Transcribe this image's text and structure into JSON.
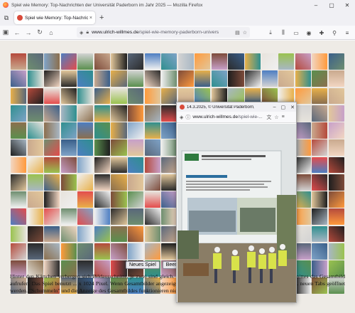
{
  "window": {
    "title": "Spiel wie Memory: Top-Nachrichten der Universität Paderborn im Jahr 2025 — Mozilla Firefox",
    "min_icon": "minimize-icon",
    "max_icon": "maximize-icon",
    "close_icon": "close-icon"
  },
  "tab": {
    "label": "Spiel wie Memory: Top-Nachrichten",
    "close": "×",
    "new": "+"
  },
  "nav": {
    "url_domain": "www.ulrich-willmes.de",
    "url_path": "/spiel-wie-memory-paderborn-univers"
  },
  "page": {
    "buttons": [
      "Neues Spiel",
      "Beenden"
    ],
    "paragraph": "Hinter den Kärtchen verbergen sich Bildausschnitte, je zwei sind gleich. I... Klicken, können Sie durch Anklicken des Ausschnittes das Gesamtbild aufrufen. Das Spiel benutzt ... x 1024 Pixel. Wenn Gesamtbilder angezeigt werden sollen, sollten Sie (falls möglich) den Brow... neuen Tabs geöffnet werden. \"Schummeln\" und die Anzeige des Gesamtbildes funktionieren nich..."
  },
  "popup": {
    "title": "14.3.2025, © Universität Paderborn, ...",
    "url_domain": "www.ulrich-willmes.de",
    "url_path": "/spiel-wie-..."
  },
  "palette": [
    "#c9a98e",
    "#2b2b2b",
    "#7fa3c7",
    "#e7e3dc",
    "#5a8f4e",
    "#b54a3c",
    "#e2c79b",
    "#3a5f8a",
    "#f0f0f0",
    "#8b6f4e",
    "#d3d3d3",
    "#1e1e1e",
    "#c7a0c9",
    "#6e8e6f",
    "#e8b04a",
    "#4d7ec2",
    "#a8b7c4",
    "#7d4b3a",
    "#f2d6c2",
    "#59677a",
    "#e34c4c",
    "#2f8f8f",
    "#9ac24f",
    "#ff9a3c"
  ]
}
